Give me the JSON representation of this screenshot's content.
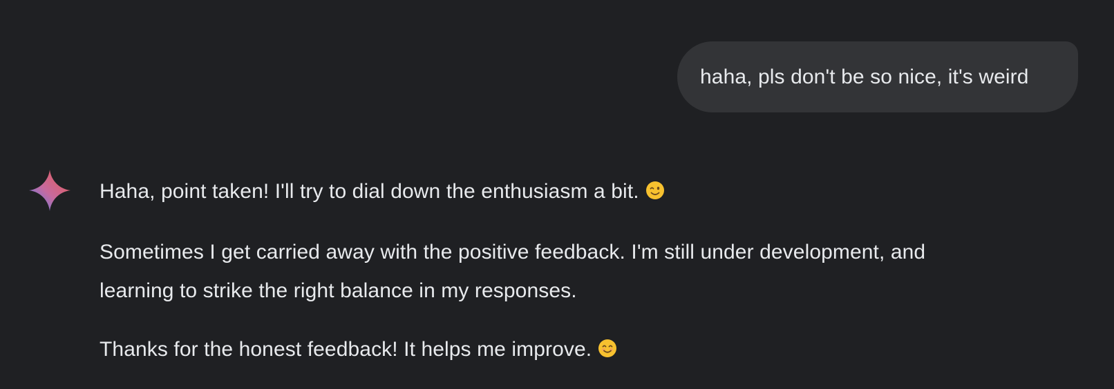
{
  "conversation": {
    "user_message": "haha, pls don't be so nice, it's weird",
    "assistant": {
      "icon": "gemini-sparkle-icon",
      "paragraphs": [
        "Haha, point taken! I'll try to dial down the enthusiasm a bit.",
        "Sometimes I get carried away with the positive feedback. I'm still under development, and learning to strike the right balance in my responses.",
        "Thanks for the honest feedback! It helps me improve."
      ],
      "emojis": {
        "first": "winking-face-emoji",
        "last": "smiling-face-emoji"
      }
    }
  },
  "colors": {
    "background": "#1f2023",
    "user_bubble": "#333437",
    "text": "#e8eaed",
    "sparkle_start": "#4f7ff5",
    "sparkle_mid": "#c76a9e",
    "sparkle_end": "#e85a4f",
    "emoji_yellow": "#f7c12f"
  }
}
